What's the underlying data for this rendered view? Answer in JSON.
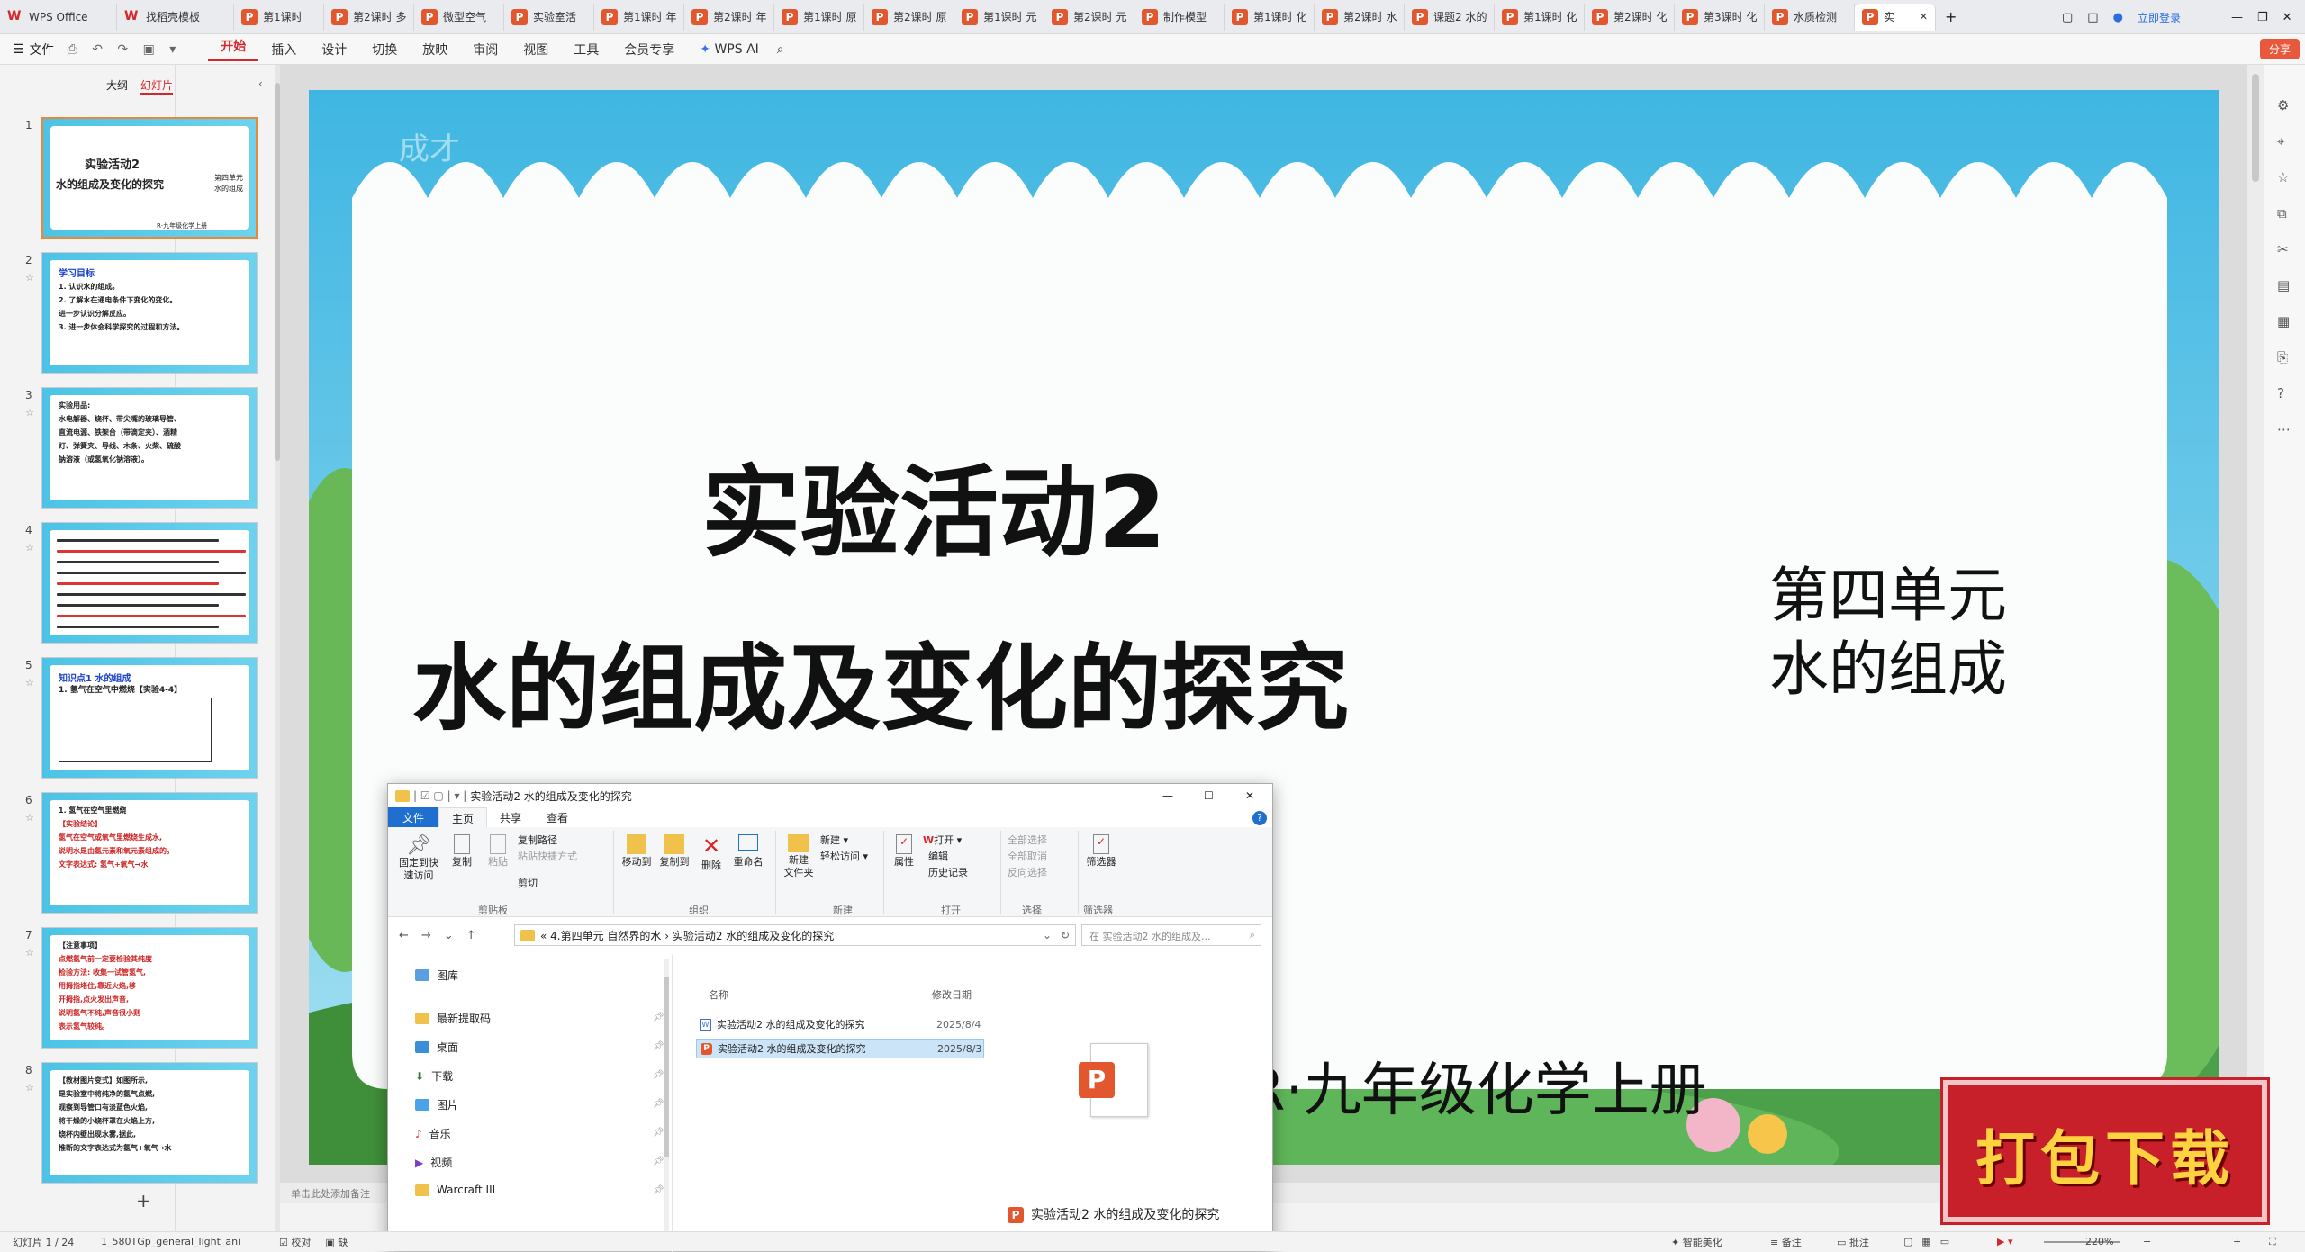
{
  "tabs": [
    {
      "label": "WPS Office",
      "kind": "home"
    },
    {
      "label": "找稻壳模板",
      "kind": "home"
    },
    {
      "label": "第1课时",
      "kind": "ppt"
    },
    {
      "label": "第2课时 多",
      "kind": "ppt"
    },
    {
      "label": "微型空气",
      "kind": "ppt"
    },
    {
      "label": "实验室活",
      "kind": "ppt"
    },
    {
      "label": "第1课时 年",
      "kind": "ppt"
    },
    {
      "label": "第2课时 年",
      "kind": "ppt"
    },
    {
      "label": "第1课时 原",
      "kind": "ppt"
    },
    {
      "label": "第2课时 原",
      "kind": "ppt"
    },
    {
      "label": "第1课时 元",
      "kind": "ppt"
    },
    {
      "label": "第2课时 元",
      "kind": "ppt"
    },
    {
      "label": "制作模型",
      "kind": "ppt"
    },
    {
      "label": "第1课时 化",
      "kind": "ppt"
    },
    {
      "label": "第2课时 水",
      "kind": "ppt"
    },
    {
      "label": "课题2 水的",
      "kind": "ppt"
    },
    {
      "label": "第1课时 化",
      "kind": "ppt"
    },
    {
      "label": "第2课时 化",
      "kind": "ppt"
    },
    {
      "label": "第3课时 化",
      "kind": "ppt"
    },
    {
      "label": "水质检测",
      "kind": "ppt"
    },
    {
      "label": "实",
      "kind": "active"
    }
  ],
  "titlebar": {
    "login": "立即登录",
    "share": "分享"
  },
  "ribbon": {
    "file": "文件",
    "tabs": [
      "开始",
      "插入",
      "设计",
      "切换",
      "放映",
      "审阅",
      "视图",
      "工具",
      "会员专享"
    ],
    "wpsai": "WPS AI"
  },
  "leftpanel": {
    "outline": "大纲",
    "slides": "幻灯片",
    "add": "+"
  },
  "thumbs": [
    {
      "num": "1",
      "title": "实验活动2",
      "sub": "水的组成及变化的探究",
      "side1": "第四单元",
      "side2": "水的组成",
      "foot": "R·九年级化学上册"
    },
    {
      "num": "2",
      "heading": "学习目标",
      "lines": [
        "1. 认识水的组成。",
        "2. 了解水在通电条件下变化的变化。",
        "进一步认识分解反应。",
        "3. 进一步体会科学探究的过程和方法。"
      ]
    },
    {
      "num": "3",
      "lines": [
        "实验用品:",
        "水电解器、烧杯、带尖嘴的玻璃导管、",
        "直流电源、铁架台（带滴定夹）、酒精",
        "灯、弹簧夹、导线、木条、火柴、硫酸",
        "钠溶液（或氢氧化钠溶液）。"
      ]
    },
    {
      "num": "4"
    },
    {
      "num": "5",
      "heading": "知识点1  水的组成",
      "sub": "1. 氢气在空气中燃烧【实验4-4】"
    },
    {
      "num": "6",
      "lines": [
        "1. 氢气在空气里燃烧",
        "【实验结论】",
        "氢气在空气或氧气里燃烧生成水,",
        "说明水是由氢元素和氧元素组成的。",
        "文字表达式: 氢气+氧气→水"
      ]
    },
    {
      "num": "7",
      "lines": [
        "【注意事项】",
        "点燃氢气前一定要检验其纯度",
        "检验方法: 收集一试管氢气,",
        "用拇指堵住,靠近火焰,移",
        "开拇指,点火发出声音,",
        "说明氢气不纯,声音很小则",
        "表示氢气较纯。"
      ]
    },
    {
      "num": "8",
      "lines": [
        "【教材图片变式】如图所示,",
        "是实验室中将纯净的氢气点燃,",
        "观察到导管口有淡蓝色火焰,",
        "将干燥的小烧杯罩在火焰上方,",
        "烧杯内壁出现水雾,据此,",
        "推断的文字表达式为氢气+氧气→水"
      ]
    }
  ],
  "slide": {
    "title": "实验活动2",
    "subtitle": "水的组成及变化的探究",
    "unit": "第四单元",
    "topic": "水的组成",
    "footer": "R·九年级化学上册",
    "watermark": "成才"
  },
  "notes_placeholder": "单击此处添加备注",
  "badge": "打包下载",
  "explorer": {
    "title": "实验活动2 水的组成及变化的探究",
    "ribbon_tabs": [
      "文件",
      "主页",
      "共享",
      "查看"
    ],
    "clipboard": {
      "pin": "固定到快速访问",
      "copy": "复制",
      "paste": "粘贴",
      "copy_path": "复制路径",
      "paste_shortcut": "粘贴快捷方式",
      "cut": "剪切",
      "group": "剪贴板"
    },
    "organize": {
      "move": "移动到",
      "copyto": "复制到",
      "delete": "删除",
      "rename": "重命名",
      "group": "组织"
    },
    "new": {
      "folder": "新建\n文件夹",
      "item": "新建",
      "easy": "轻松访问",
      "group": "新建"
    },
    "open": {
      "props": "属性",
      "open": "打开",
      "edit": "编辑",
      "history": "历史记录",
      "group": "打开"
    },
    "select": {
      "all": "全部选择",
      "none": "全部取消",
      "invert": "反向选择",
      "group": "选择"
    },
    "filter": {
      "label": "筛选器",
      "group": "筛选器"
    },
    "path": "«  4.第四单元 自然界的水  ›  实验活动2 水的组成及变化的探究",
    "search_placeholder": "在 实验活动2 水的组成及...",
    "col_name": "名称",
    "col_date": "修改日期",
    "nav": [
      "图库",
      "最新提取码",
      "桌面",
      "下载",
      "图片",
      "音乐",
      "视频",
      "Warcraft III"
    ],
    "files": [
      {
        "name": "实验活动2 水的组成及变化的探究",
        "date": "2025/8/4"
      },
      {
        "name": "实验活动2 水的组成及变化的探究",
        "date": "2025/8/3"
      }
    ],
    "preview_name": "实验活动2 水的组成及变化的探究",
    "preview_letter": "P"
  },
  "status": {
    "slide": "幻灯片 1 / 24",
    "theme": "1_580TGp_general_light_ani",
    "check": "校对",
    "missing": "缺",
    "beautify": "智能美化",
    "notes": "备注",
    "comment": "批注",
    "zoom": "220%"
  }
}
